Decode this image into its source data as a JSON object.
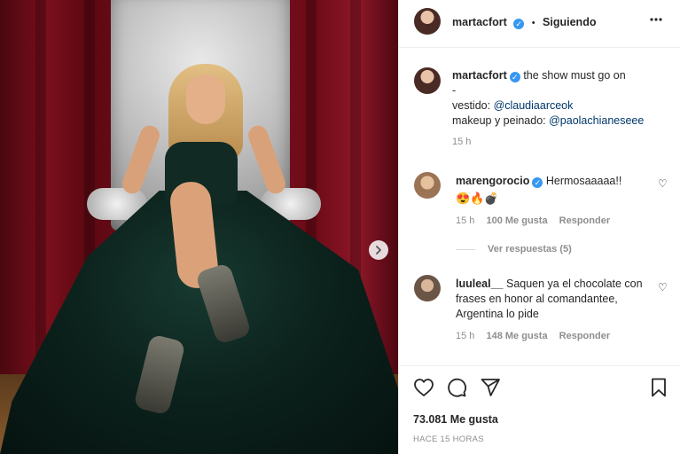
{
  "post": {
    "author": "martacfort",
    "follow_status": "Siguiendo",
    "separator": "•",
    "more_icon": "more-horizontal-icon"
  },
  "caption": {
    "author": "martacfort",
    "text": "the show must go on",
    "dash": "-",
    "line_dress_prefix": "vestido: ",
    "line_dress_mention": "@claudiaarceok",
    "line_makeup_prefix": "makeup y peinado: ",
    "line_makeup_mention": "@paolachianeseee",
    "time": "15 h"
  },
  "comments": [
    {
      "author": "marengorocio",
      "verified": true,
      "text": "Hermosaaaaa!!",
      "emojis": "😍🔥💣",
      "time": "15 h",
      "likes": "100 Me gusta",
      "reply": "Responder",
      "view_replies": "Ver respuestas (5)"
    },
    {
      "author": "luuleal__",
      "verified": false,
      "text": "Saquen ya el chocolate con frases en honor al comandantee, Argentina lo pide",
      "time": "15 h",
      "likes": "148 Me gusta",
      "reply": "Responder"
    }
  ],
  "actions": {
    "likes_count": "73.081 Me gusta",
    "posted_ago": "HACE 15 HORAS",
    "icons": [
      "heart-icon",
      "comment-icon",
      "share-icon",
      "bookmark-icon"
    ]
  },
  "colors": {
    "verified": "#3897f0",
    "link": "#00376b",
    "muted": "#8e8e8e"
  }
}
